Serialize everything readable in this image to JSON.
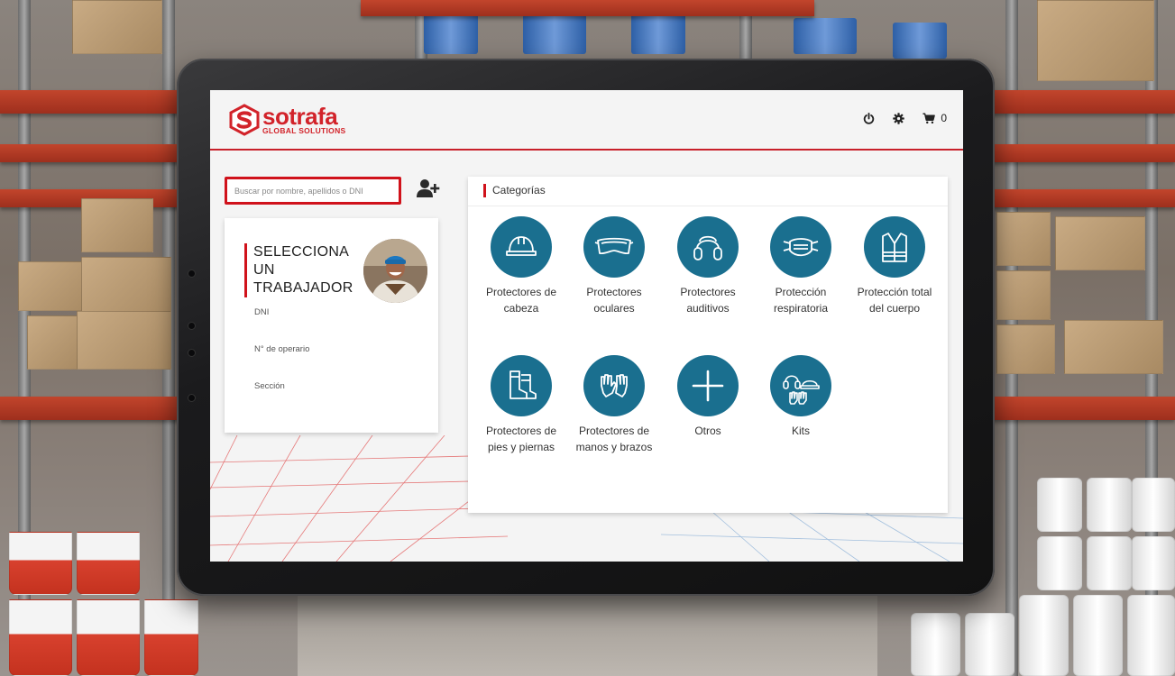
{
  "brand": {
    "name": "sotrafa",
    "tagline": "GLOBAL SOLUTIONS",
    "color": "#d2232a"
  },
  "header": {
    "power_icon": "power-icon",
    "settings_icon": "gear-icon",
    "cart_icon": "cart-icon",
    "cart_count": "0"
  },
  "search": {
    "placeholder": "Buscar por nombre, apellidos o DNI",
    "value": ""
  },
  "worker": {
    "title": "SELECCIONA UN TRABAJADOR",
    "fields": {
      "dni": "DNI",
      "operator": "N° de operario",
      "section": "Sección"
    }
  },
  "categories": {
    "title": "Categorías",
    "accent": "#1a6f8f",
    "items": [
      {
        "label": "Protectores de cabeza",
        "icon": "hard-hat-icon"
      },
      {
        "label": "Protectores oculares",
        "icon": "goggles-icon"
      },
      {
        "label": "Protectores auditivos",
        "icon": "earmuffs-icon"
      },
      {
        "label": "Protección respiratoria",
        "icon": "mask-icon"
      },
      {
        "label": "Protección total del cuerpo",
        "icon": "vest-icon"
      },
      {
        "label": "Protectores de pies y piernas",
        "icon": "boots-icon"
      },
      {
        "label": "Protectores de manos y brazos",
        "icon": "gloves-icon"
      },
      {
        "label": "Otros",
        "icon": "plus-icon"
      },
      {
        "label": "Kits",
        "icon": "kit-icon"
      }
    ]
  }
}
